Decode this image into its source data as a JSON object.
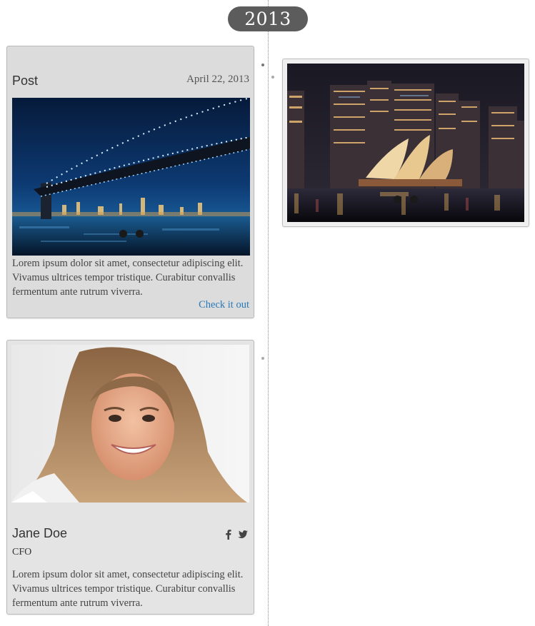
{
  "timeline": {
    "year": "2013"
  },
  "post_card": {
    "title": "Post",
    "date": "April 22, 2013",
    "image": "bridge-night-photo",
    "text": "Lorem ipsum dolor sit amet, consectetur adipiscing elit. Vivamus ultrices tempor tristique. Curabitur convallis fermentum ante rutrum viverra.",
    "link_label": "Check it out",
    "carousel_slides": 2
  },
  "photo_card": {
    "image": "sydney-opera-house-night-photo",
    "carousel_slides": 2
  },
  "profile_card": {
    "image": "smiling-woman-portrait",
    "name": "Jane Doe",
    "role": "CFO",
    "text": "Lorem ipsum dolor sit amet, consectetur adipiscing elit. Vivamus ultrices tempor tristique. Curabitur convallis fermentum ante rutrum viverra.",
    "social": [
      "facebook-icon",
      "twitter-icon"
    ]
  },
  "colors": {
    "badge_bg": "#5c5c5c",
    "link": "#2a7ab8",
    "card_bg": "#dcdcdc"
  }
}
